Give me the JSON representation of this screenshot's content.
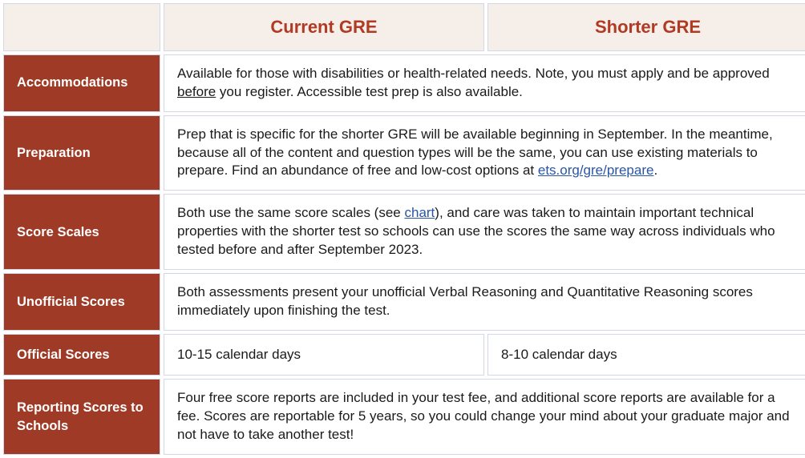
{
  "headers": {
    "current": "Current GRE",
    "shorter": "Shorter GRE"
  },
  "rows": {
    "accommodations": {
      "label": "Accommodations",
      "text_before": "Available for those with disabilities or health-related needs. Note, you must apply and be approved ",
      "underlined": "before",
      "text_after": " you register. Accessible test prep is also available."
    },
    "preparation": {
      "label": "Preparation",
      "text_before": "Prep that is specific for the shorter GRE will be available beginning in September. In the meantime, because all of the content and question types will be the same, you can use existing materials to prepare. Find an abundance of free and low-cost options at ",
      "link_text": "ets.org/gre/prepare",
      "text_after": "."
    },
    "score_scales": {
      "label": "Score Scales",
      "text_before": "Both use the same score scales (see ",
      "link_text": "chart",
      "text_after": "), and care was taken to maintain important technical properties with the shorter test so schools can use the scores the same way across individuals who tested before and after September 2023."
    },
    "unofficial_scores": {
      "label": "Unofficial Scores",
      "text": "Both assessments present your unofficial Verbal Reasoning and Quantitative Reasoning scores immediately upon finishing the test."
    },
    "official_scores": {
      "label": "Official Scores",
      "current": "10-15 calendar days",
      "shorter": "8-10 calendar days"
    },
    "reporting": {
      "label": "Reporting Scores to Schools",
      "text": "Four free score reports are included in your test fee, and additional score reports are available for a fee. Scores are reportable for 5 years, so you could change your mind about your graduate major and not have to take another test!"
    }
  }
}
